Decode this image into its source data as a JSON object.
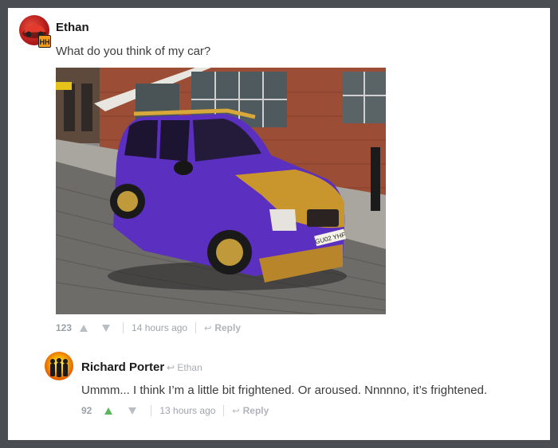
{
  "comments": [
    {
      "author": "Ethan",
      "text": "What do you think of my car?",
      "avatar_badge": "HH",
      "votes": "123",
      "time": "14 hours ago",
      "reply_label": "Reply",
      "upvoted": false,
      "image_plate": "GU02 YHF"
    },
    {
      "author": "Richard Porter",
      "reply_to": "Ethan",
      "text": "Ummm... I think I’m a little bit frightened. Or aroused. Nnnnno, it’s frightened.",
      "votes": "92",
      "time": "13 hours ago",
      "reply_label": "Reply",
      "upvoted": true
    }
  ],
  "colors": {
    "upvote_active": "#5cb85c",
    "car_body": "#5b2fbf",
    "car_gold": "#c9962e",
    "frame_border": "#4a4d52"
  },
  "icons": [
    "upvote-arrow-icon",
    "downvote-arrow-icon",
    "reply-arrow-icon"
  ]
}
